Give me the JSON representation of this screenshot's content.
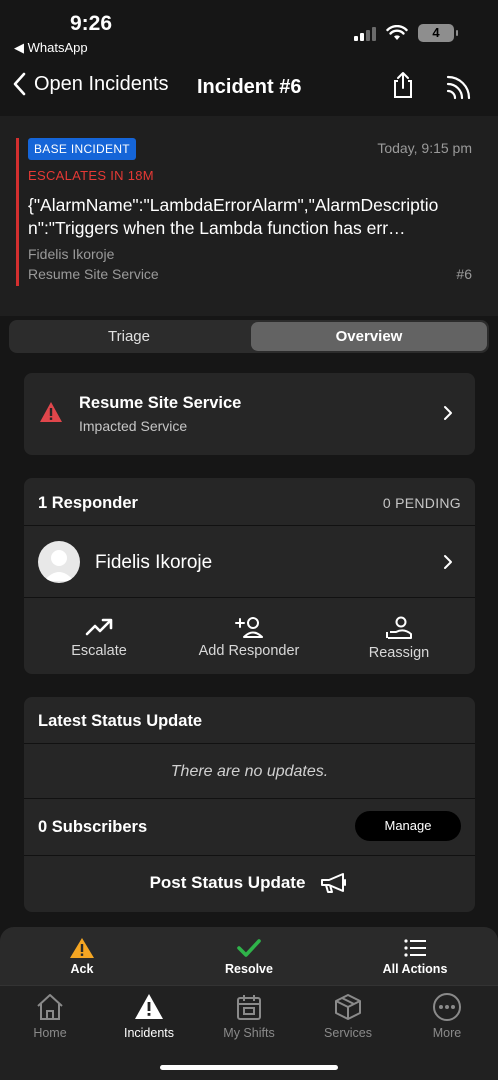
{
  "status_bar": {
    "time": "9:26",
    "back_app": "◀ WhatsApp",
    "battery": "4"
  },
  "nav": {
    "back_label": "Open Incidents",
    "title": "Incident #6"
  },
  "incident": {
    "badge": "BASE INCIDENT",
    "time": "Today, 9:15 pm",
    "escalation": "ESCALATES IN 18M",
    "summary": "{\"AlarmName\":\"LambdaErrorAlarm\",\"AlarmDescription\":\"Triggers when the Lambda function has err…",
    "assignee": "Fidelis Ikoroje",
    "service": "Resume Site Service",
    "number": "#6"
  },
  "tabs": {
    "triage": "Triage",
    "overview": "Overview"
  },
  "impacted_service": {
    "name": "Resume Site Service",
    "subtitle": "Impacted Service"
  },
  "responders": {
    "heading": "1 Responder",
    "pending": "0 PENDING",
    "name": "Fidelis Ikoroje",
    "actions": {
      "escalate": "Escalate",
      "add": "Add Responder",
      "reassign": "Reassign"
    }
  },
  "status_updates": {
    "heading": "Latest Status Update",
    "empty": "There are no updates.",
    "subscribers": "0 Subscribers",
    "manage": "Manage",
    "post": "Post Status Update"
  },
  "action_bar": {
    "ack": "Ack",
    "resolve": "Resolve",
    "all_actions": "All Actions"
  },
  "tab_bar": {
    "home": "Home",
    "incidents": "Incidents",
    "my_shifts": "My Shifts",
    "services": "Services",
    "more": "More"
  },
  "colors": {
    "escalation_red": "#e53935",
    "badge_blue": "#1565d8",
    "warning_yellow": "#f5a623",
    "resolve_green": "#2fb34a"
  }
}
